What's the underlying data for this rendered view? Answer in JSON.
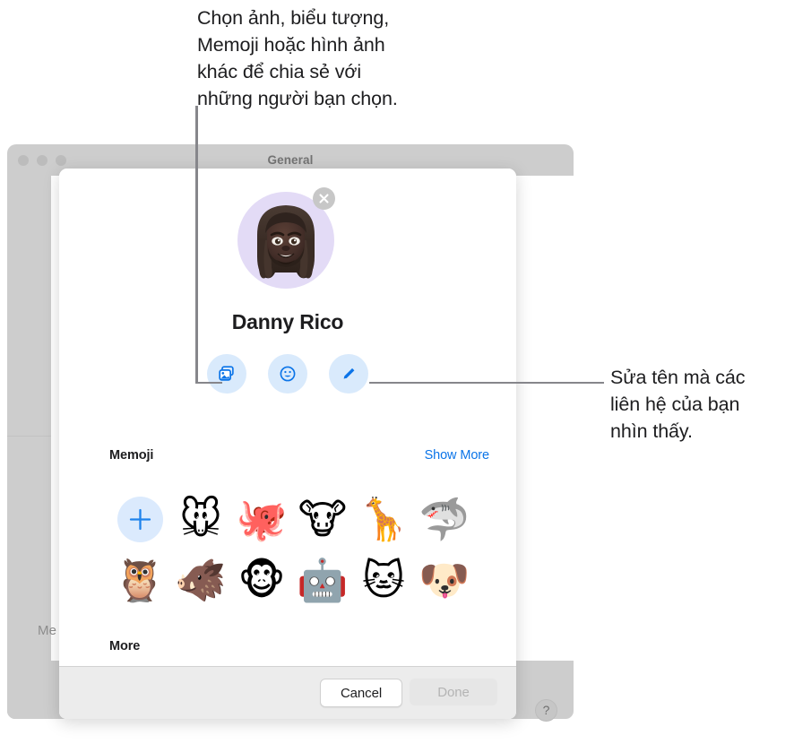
{
  "annotations": {
    "top": "Chọn ảnh, biểu tượng,\nMemoji hoặc hình ảnh\nkhác để chia sẻ với\nnhững người bạn chọn.",
    "right": "Sửa tên mà các\nliên hệ của bạn\nnhìn thấy."
  },
  "background_window": {
    "title": "General",
    "ghost_label": "Me",
    "help_glyph": "?"
  },
  "dialog": {
    "avatar": {
      "name": "memoji-avatar",
      "background_color": "#e3dbf6",
      "remove_glyph": "✕"
    },
    "display_name": "Danny Rico",
    "actions": [
      {
        "name": "photos-icon",
        "label": "Photos"
      },
      {
        "name": "emoji-icon",
        "label": "Emoji"
      },
      {
        "name": "edit-pencil-icon",
        "label": "Edit"
      }
    ],
    "memoji_section": {
      "title": "Memoji",
      "show_more": "Show More",
      "add_glyph": "+",
      "items": [
        {
          "name": "memoji-mouse",
          "glyph": "🐭"
        },
        {
          "name": "memoji-octopus",
          "glyph": "🐙"
        },
        {
          "name": "memoji-cow",
          "glyph": "🐮"
        },
        {
          "name": "memoji-giraffe",
          "glyph": "🦒"
        },
        {
          "name": "memoji-shark",
          "glyph": "🦈"
        },
        {
          "name": "memoji-owl",
          "glyph": "🦉"
        },
        {
          "name": "memoji-boar",
          "glyph": "🐗"
        },
        {
          "name": "memoji-monkey",
          "glyph": "🐵"
        },
        {
          "name": "memoji-robot",
          "glyph": "🤖"
        },
        {
          "name": "memoji-cat",
          "glyph": "🐱"
        },
        {
          "name": "memoji-dog",
          "glyph": "🐶"
        }
      ]
    },
    "more_section": {
      "title": "More"
    },
    "footer": {
      "cancel_label": "Cancel",
      "done_label": "Done"
    }
  },
  "colors": {
    "accent_blue": "#0b74e8",
    "action_button_bg": "#d9eafc",
    "window_chrome": "#cdcdcd",
    "footer_bg": "#ececec"
  }
}
